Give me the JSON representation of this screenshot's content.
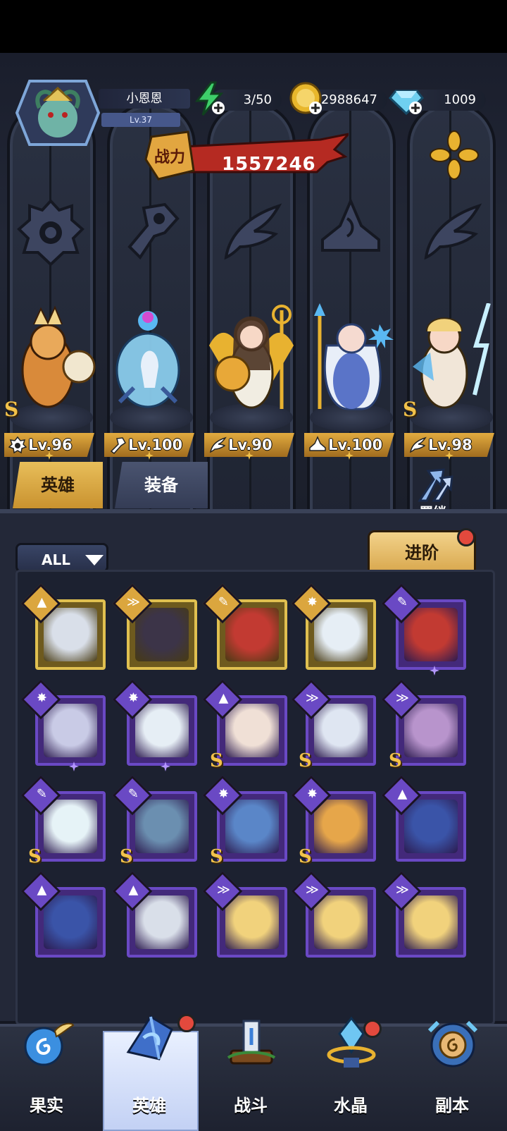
{
  "player": {
    "name": "小恩恩",
    "level": "Lv.37",
    "avatar_icon": "medusa-avatar-icon"
  },
  "resources": {
    "stamina": "3/50",
    "gold": "2988647",
    "diamonds": "1009"
  },
  "power": {
    "label": "战力",
    "value": "1557246"
  },
  "lineup": [
    {
      "class_icon": "beast-class-icon",
      "level": "Lv.96",
      "rank": "S"
    },
    {
      "class_icon": "mech-class-icon",
      "level": "Lv.100",
      "rank": ""
    },
    {
      "class_icon": "wing-class-icon",
      "level": "Lv.90",
      "rank": ""
    },
    {
      "class_icon": "mage-class-icon",
      "level": "Lv.100",
      "rank": ""
    },
    {
      "class_icon": "wing-class-icon",
      "level": "Lv.98",
      "rank": "S"
    }
  ],
  "tabs": {
    "heroes": "英雄",
    "equipment": "装备",
    "bond": "羁绊"
  },
  "filter": {
    "label": "ALL"
  },
  "advance_button": "进阶",
  "roster": [
    {
      "class": "mage",
      "frame": "gold",
      "rank": "",
      "star": false,
      "portrait_color": "#d9dfe9"
    },
    {
      "class": "wing",
      "frame": "gold",
      "rank": "",
      "star": false,
      "portrait_color": "#3c3448"
    },
    {
      "class": "mech",
      "frame": "gold",
      "rank": "",
      "star": false,
      "portrait_color": "#c23a32"
    },
    {
      "class": "beast",
      "frame": "gold",
      "rank": "",
      "star": false,
      "portrait_color": "#e6eef5"
    },
    {
      "class": "mech",
      "frame": "purple",
      "rank": "",
      "star": true,
      "portrait_color": "#c23a32"
    },
    {
      "class": "beast",
      "frame": "purple",
      "rank": "",
      "star": true,
      "portrait_color": "#c9cbe6"
    },
    {
      "class": "beast",
      "frame": "purple",
      "rank": "",
      "star": true,
      "portrait_color": "#e6eef5"
    },
    {
      "class": "mage",
      "frame": "purple",
      "rank": "S",
      "star": false,
      "portrait_color": "#f0e0d6"
    },
    {
      "class": "wing",
      "frame": "purple",
      "rank": "S",
      "star": false,
      "portrait_color": "#dfe6f2"
    },
    {
      "class": "wing",
      "frame": "purple",
      "rank": "S",
      "star": false,
      "portrait_color": "#b894cc"
    },
    {
      "class": "mech",
      "frame": "purple",
      "rank": "S",
      "star": false,
      "portrait_color": "#e6f3f7"
    },
    {
      "class": "mech",
      "frame": "purple",
      "rank": "S",
      "star": false,
      "portrait_color": "#6b8fb0"
    },
    {
      "class": "beast",
      "frame": "purple",
      "rank": "S",
      "star": false,
      "portrait_color": "#5a86c8"
    },
    {
      "class": "beast",
      "frame": "purple",
      "rank": "S",
      "star": false,
      "portrait_color": "#e6a64a"
    },
    {
      "class": "mage",
      "frame": "purple",
      "rank": "",
      "star": false,
      "portrait_color": "#3a54a8"
    },
    {
      "class": "mage",
      "frame": "purple",
      "rank": "",
      "star": false,
      "portrait_color": "#3a54a8"
    },
    {
      "class": "mage",
      "frame": "purple",
      "rank": "",
      "star": false,
      "portrait_color": "#d9dfe9"
    },
    {
      "class": "wing",
      "frame": "purple",
      "rank": "",
      "star": false,
      "portrait_color": "#f1d27c"
    },
    {
      "class": "wing",
      "frame": "purple",
      "rank": "",
      "star": false,
      "portrait_color": "#f1d27c"
    },
    {
      "class": "wing",
      "frame": "purple",
      "rank": "",
      "star": false,
      "portrait_color": "#f1d27c"
    }
  ],
  "nav": [
    {
      "label": "果实",
      "icon": "fruit-icon",
      "selected": false,
      "badge": false
    },
    {
      "label": "英雄",
      "icon": "hero-icon",
      "selected": true,
      "badge": true
    },
    {
      "label": "战斗",
      "icon": "battle-icon",
      "selected": false,
      "badge": false
    },
    {
      "label": "水晶",
      "icon": "crystal-icon",
      "selected": false,
      "badge": true
    },
    {
      "label": "副本",
      "icon": "dungeon-icon",
      "selected": false,
      "badge": false
    }
  ]
}
